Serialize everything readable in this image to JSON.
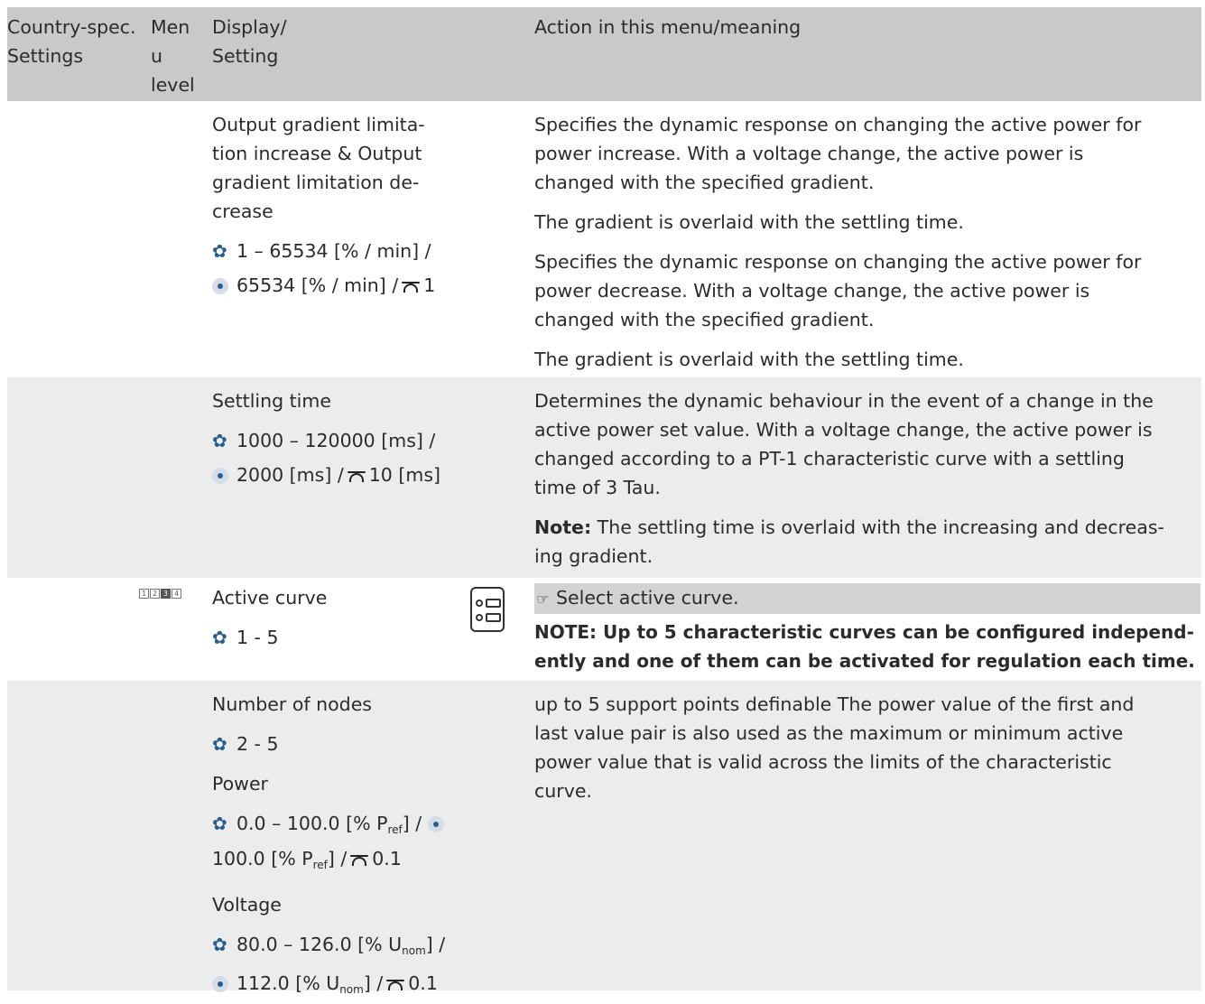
{
  "header": {
    "col1": [
      "Country-spec.",
      "Settings"
    ],
    "col2": [
      "Men",
      "u",
      "level"
    ],
    "col3": [
      "Display/",
      "Setting"
    ],
    "col4": "Action in this menu/meaning"
  },
  "row1": {
    "setting_lines": [
      "Output gradient limita-",
      "tion increase & Output",
      "gradient limitation de-",
      "crease"
    ],
    "range": "1 – 65534 [% / min] /",
    "default": "65534 [% / min] /",
    "step": "1",
    "desc": [
      [
        "Specifies the dynamic response on changing the active power for",
        "power increase. With a voltage change, the active power is",
        "changed with the specified gradient."
      ],
      [
        "The gradient is overlaid with the settling time."
      ],
      [
        "Specifies the dynamic response on changing the active power for",
        "power decrease. With a voltage change, the active power is",
        "changed with the specified gradient."
      ],
      [
        "The gradient is overlaid with the settling time."
      ]
    ]
  },
  "row2": {
    "setting": "Settling time",
    "range": "1000 – 120000 [ms] /",
    "default": "2000 [ms] /",
    "step": "10 [ms]",
    "desc": [
      "Determines the dynamic behaviour in the event of a change in the",
      "active power set value. With a voltage change, the active power is",
      "changed according to a PT-1 characteristic curve with a settling",
      "time of 3 Tau."
    ],
    "note_label": "Note:",
    "note_first": " The settling time is overlaid with the increasing and decreas-",
    "note_second": "ing gradient."
  },
  "row3": {
    "level_boxes": [
      "1",
      "2",
      "3",
      "4"
    ],
    "setting": "Active curve",
    "range": "1 - 5",
    "instruction": "Select active curve.",
    "note": [
      "NOTE: Up to 5 characteristic curves can be configured independ-",
      "ently and one of them can be activated for regulation each time."
    ]
  },
  "row4": {
    "nodes_label": "Number of nodes",
    "nodes_range": "2 - 5",
    "power_label": "Power",
    "power_range_a": "0.0 – 100.0 [% P",
    "power_sub": "ref",
    "power_range_b": "] /",
    "power_default_a": "100.0 [% P",
    "power_default_b": "] /",
    "power_step": "0.1",
    "voltage_label": "Voltage",
    "voltage_range_a": "80.0 – 126.0 [% U",
    "voltage_sub": "nom",
    "voltage_range_b": "] /",
    "voltage_default_a": "112.0 [% U",
    "voltage_default_b": "] /",
    "voltage_step": "0.1",
    "desc": [
      "up to 5 support points definable The power value of the first and",
      "last value pair is also used as the maximum or minimum active",
      "power value that is valid across the limits of the characteristic",
      "curve."
    ]
  },
  "colors": {
    "header_bg": "#c9c9c9",
    "shaded_bg": "#ececec",
    "icon_blue": "#2b5d8c"
  },
  "icons": [
    "gear-icon",
    "default-dot-icon",
    "step-icon",
    "menu-list-icon",
    "pointing-hand-icon",
    "menu-level-icon"
  ]
}
